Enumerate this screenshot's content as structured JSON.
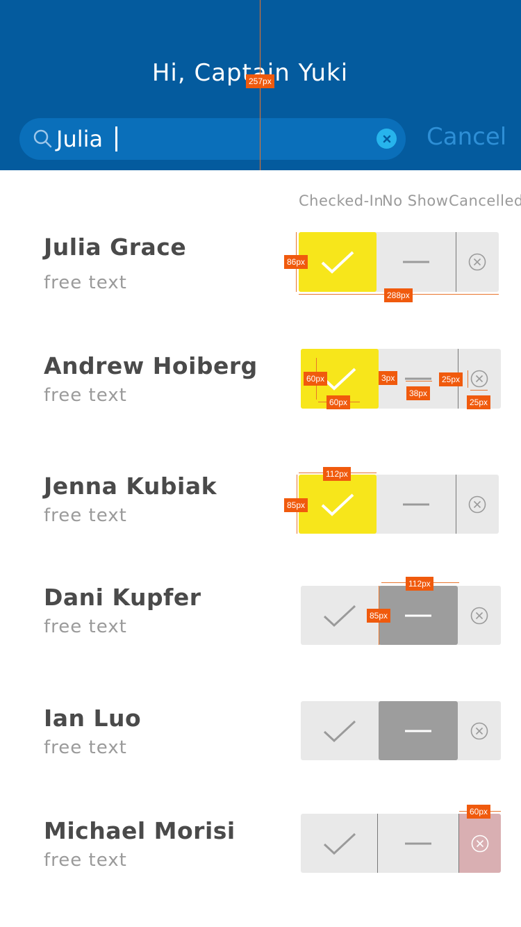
{
  "header": {
    "greeting": "Hi, Captain Yuki",
    "search": {
      "value": "Julia",
      "icon": "search-icon",
      "clear_icon": "close-icon"
    },
    "cancel_label": "Cancel"
  },
  "columns": {
    "checked_in": "Checked-In",
    "no_show": "No Show",
    "cancelled": "Cancelled"
  },
  "guests": [
    {
      "name": "Julia Grace",
      "note": "free text",
      "status": "checked-in"
    },
    {
      "name": "Andrew Hoiberg",
      "note": "free text",
      "status": "checked-in"
    },
    {
      "name": "Jenna Kubiak",
      "note": "free text",
      "status": "checked-in"
    },
    {
      "name": "Dani Kupfer",
      "note": "free text",
      "status": "no-show"
    },
    {
      "name": "Ian Luo",
      "note": "free text",
      "status": "no-show"
    },
    {
      "name": "Michael Morisi",
      "note": "free text",
      "status": "cancelled"
    }
  ],
  "colors": {
    "header_bg": "#045b9e",
    "search_bg": "#0a6fba",
    "checked_in": "#f7e61b",
    "no_show": "#9d9d9d",
    "cancelled": "#d9afb2",
    "annotation": "#f05a0d"
  },
  "annotations": {
    "a1": "257px",
    "a2": "86px",
    "a3": "288px",
    "a4": "60px",
    "a5": "60px",
    "a6": "3px",
    "a7": "38px",
    "a8": "25px",
    "a9": "25px",
    "a10": "112px",
    "a11": "85px",
    "a12": "112px",
    "a13": "85px",
    "a14": "60px"
  }
}
